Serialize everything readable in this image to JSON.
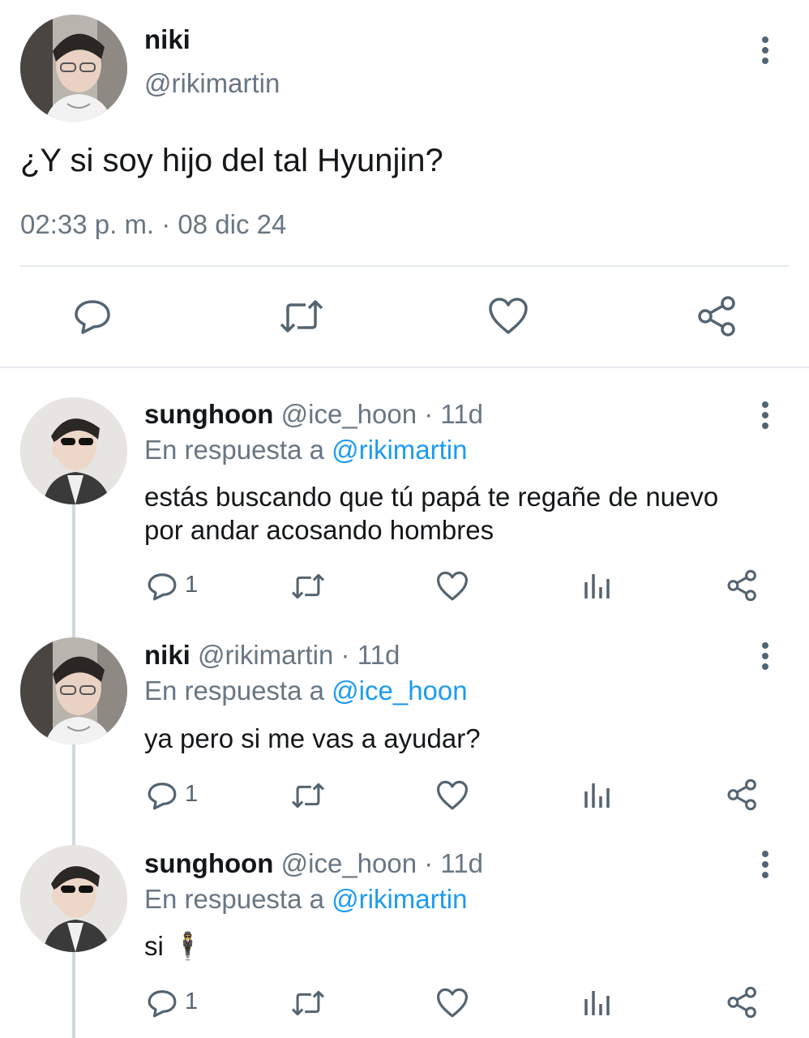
{
  "main_tweet": {
    "name": "niki",
    "handle": "@rikimartin",
    "text": "¿Y si soy hijo del tal Hyunjin?",
    "timestamp": "02:33 p. m. · 08 dic 24",
    "avatar_icon": "user-avatar"
  },
  "replies": [
    {
      "name": "sunghoon",
      "handle": "@ice_hoon",
      "time": "· 11d",
      "reply_prefix": "En respuesta a",
      "reply_to": "@rikimartin",
      "text_line1": "estás buscando que tú papá te regañe de nuevo",
      "text_line2": "por andar acosando hombres",
      "reply_count": "1"
    },
    {
      "name": "niki",
      "handle": "@rikimartin",
      "time": "· 11d",
      "reply_prefix": "En respuesta a",
      "reply_to": "@ice_hoon",
      "text_line1": "ya pero si me vas a ayudar?",
      "reply_count": "1"
    },
    {
      "name": "sunghoon",
      "handle": "@ice_hoon",
      "time": "· 11d",
      "reply_prefix": "En respuesta a",
      "reply_to": "@rikimartin",
      "text_line1": "si 🕴",
      "reply_count": "1"
    }
  ],
  "colors": {
    "link": "#1d9bf0",
    "muted": "#687684",
    "icon": "#536471",
    "divider": "#e1e8ed"
  }
}
